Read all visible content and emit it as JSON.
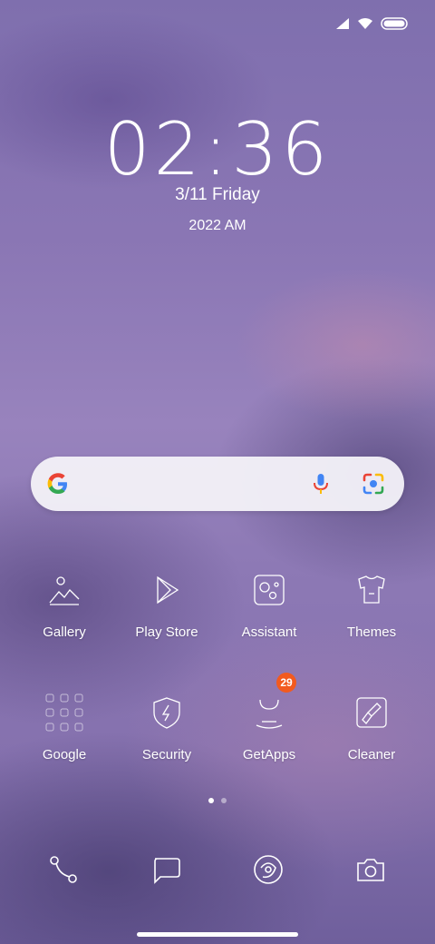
{
  "status": {
    "signal_icon": "signal-icon",
    "wifi_icon": "wifi-icon",
    "battery_icon": "battery-icon"
  },
  "clock": {
    "time": "02:36",
    "date": "3/11  Friday",
    "year": "2022  AM"
  },
  "search": {
    "google_icon": "google-g-icon",
    "mic_icon": "mic-icon",
    "lens_icon": "lens-icon"
  },
  "apps": [
    {
      "label": "Gallery",
      "icon": "gallery-icon"
    },
    {
      "label": "Play Store",
      "icon": "play-store-icon"
    },
    {
      "label": "Assistant",
      "icon": "assistant-icon"
    },
    {
      "label": "Themes",
      "icon": "themes-icon"
    },
    {
      "label": "Google",
      "icon": "google-folder-icon"
    },
    {
      "label": "Security",
      "icon": "security-icon"
    },
    {
      "label": "GetApps",
      "icon": "getapps-icon",
      "badge": "29"
    },
    {
      "label": "Cleaner",
      "icon": "cleaner-icon"
    }
  ],
  "pages": {
    "count": 2,
    "active": 1
  },
  "dock": [
    {
      "icon": "phone-icon"
    },
    {
      "icon": "messages-icon"
    },
    {
      "icon": "browser-icon"
    },
    {
      "icon": "camera-icon"
    }
  ],
  "colors": {
    "badge": "#f25a1f",
    "search_bg": "#f2f0f7",
    "google_blue": "#4285f4",
    "google_red": "#ea4335",
    "google_yellow": "#fbbc05",
    "google_green": "#34a853"
  }
}
